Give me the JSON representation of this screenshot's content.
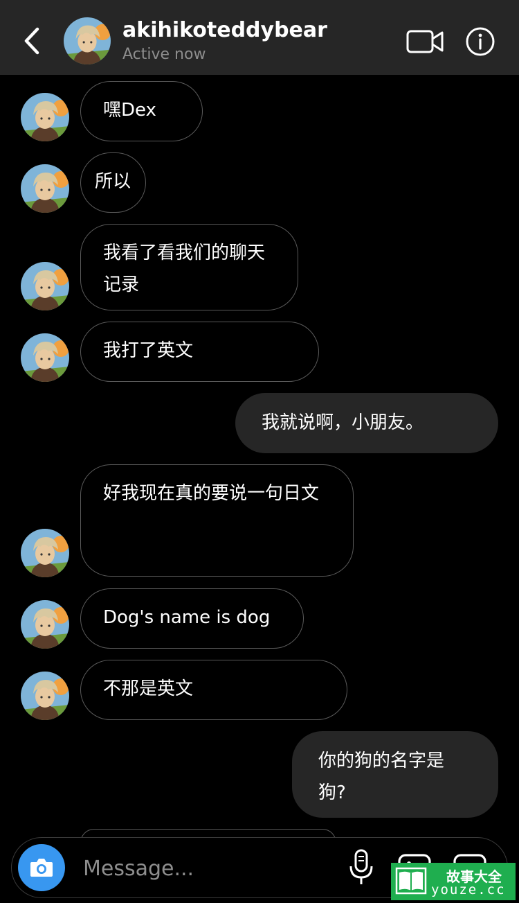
{
  "header": {
    "username": "akihikoteddybear",
    "status": "Active now"
  },
  "messages": [
    {
      "from": "them",
      "text": "嘿Dex"
    },
    {
      "from": "them",
      "text": "所以"
    },
    {
      "from": "them",
      "text": "我看了看我们的聊天\n记录"
    },
    {
      "from": "them",
      "text": "我打了英文"
    },
    {
      "from": "me",
      "text": "我就说啊，小朋友。"
    },
    {
      "from": "them",
      "text": "好我现在真的要说一句日文"
    },
    {
      "from": "them",
      "text": "Dog's name is dog"
    },
    {
      "from": "them",
      "text": "不那是英文"
    },
    {
      "from": "me",
      "text": "你的狗的名字是\n狗?"
    }
  ],
  "composer": {
    "placeholder": "Message..."
  },
  "watermark": {
    "line1": "故事大全",
    "line2": "youze.cc"
  },
  "colors": {
    "background": "#000000",
    "header": "#262626",
    "outgoing_bubble": "#262626",
    "camera_button": "#3897f0",
    "watermark": "#1fae4f"
  }
}
